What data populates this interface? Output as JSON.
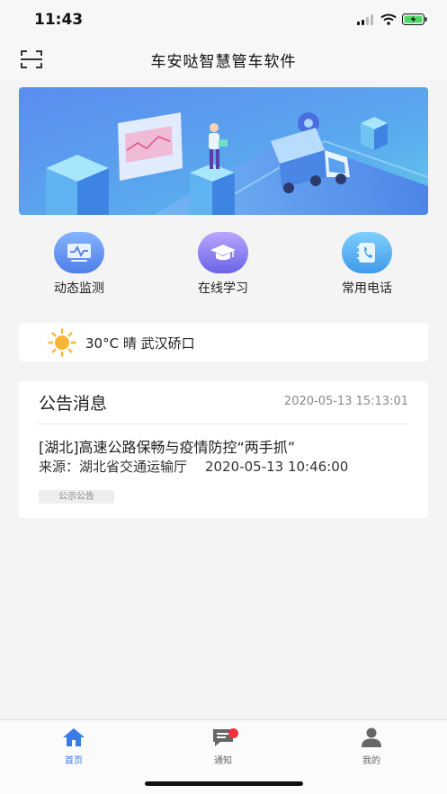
{
  "status_bar": {
    "time": "11:43"
  },
  "header": {
    "title": "车安哒智慧管车软件"
  },
  "quick_actions": [
    {
      "label": "动态监测",
      "icon": "monitor-icon"
    },
    {
      "label": "在线学习",
      "icon": "graduation-cap-icon"
    },
    {
      "label": "常用电话",
      "icon": "phone-book-icon"
    }
  ],
  "weather": {
    "text": "30°C 晴 武汉硚口",
    "icon": "sun-icon"
  },
  "notice": {
    "title": "公告消息",
    "time": "2020-05-13 15:13:01",
    "items": [
      {
        "title": "[湖北]高速公路保畅与疫情防控“两手抓”",
        "source": "来源：湖北省交通运输厅",
        "date": "2020-05-13 10:46:00",
        "tag": "公示公告"
      }
    ]
  },
  "tab_bar": {
    "tabs": [
      {
        "label": "首页",
        "active": true
      },
      {
        "label": "通知",
        "active": false
      },
      {
        "label": "我的",
        "active": false
      }
    ]
  },
  "colors": {
    "accent": "#3a7be8",
    "inactive": "#666666",
    "badge": "#f0303a"
  }
}
